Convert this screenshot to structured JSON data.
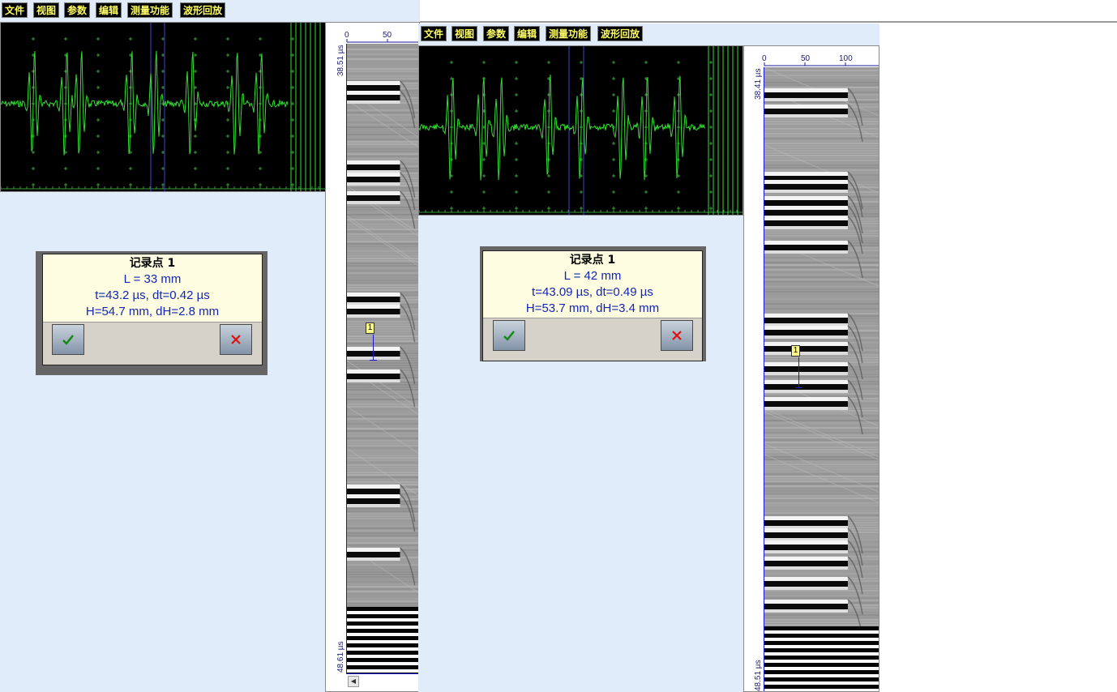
{
  "windows": [
    {
      "menu": [
        "文件",
        "视图",
        "参数",
        "编辑",
        "测量功能",
        "波形回放"
      ],
      "bscan": {
        "top_label": "38.51 µs",
        "bottom_label": "48.61 µs",
        "ruler_ticks": [
          "0",
          "50"
        ]
      },
      "dialog": {
        "title": "记录点 1",
        "line1": "L = 33 mm",
        "line2": "t=43.2 µs, dt=0.42 µs",
        "line3": "H=54.7 mm, dH=2.8 mm"
      },
      "marker": "1"
    },
    {
      "menu": [
        "文件",
        "视图",
        "参数",
        "编辑",
        "测量功能",
        "波形回放"
      ],
      "bscan": {
        "top_label": "38.41 µs",
        "bottom_label": "48.51 µs",
        "ruler_ticks": [
          "0",
          "50",
          "100"
        ]
      },
      "dialog": {
        "title": "记录点 1",
        "line1": "L = 42 mm",
        "line2": "t=43.09 µs, dt=0.49 µs",
        "line3": "H=53.7 mm, dH=3.4 mm"
      },
      "marker": "1"
    }
  ],
  "colors": {
    "background": "#e1ecfa",
    "menu_text": "#ffff66",
    "trace": "#33dd33",
    "grid": "#3c9c3c",
    "gate": "#4444cc",
    "info_text": "#1226b3",
    "ok_icon": "#118811",
    "cancel_icon": "#dd1111"
  },
  "icons": {
    "ok": "check-icon",
    "cancel": "close-icon"
  }
}
